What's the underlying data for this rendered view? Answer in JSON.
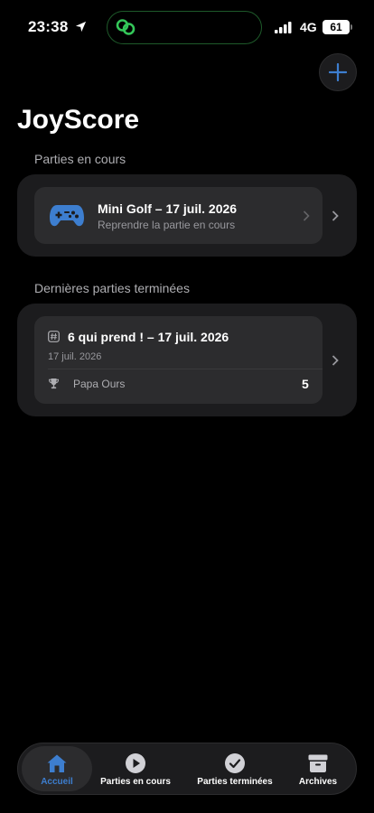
{
  "status_bar": {
    "time": "23:38",
    "network": "4G",
    "battery": "61"
  },
  "header": {
    "title": "JoyScore"
  },
  "in_progress": {
    "section_label": "Parties en cours",
    "game": {
      "title": "Mini Golf – 17 juil. 2026",
      "subtitle": "Reprendre la partie en cours"
    }
  },
  "finished": {
    "section_label": "Dernières parties terminées",
    "game": {
      "title": "6 qui prend ! – 17 juil. 2026",
      "date": "17 juil. 2026",
      "winner": "Papa Ours",
      "score": "5"
    }
  },
  "tabs": [
    {
      "label": "Accueil",
      "icon": "house-icon",
      "active": true
    },
    {
      "label": "Parties en cours",
      "icon": "play-circle-icon",
      "active": false
    },
    {
      "label": "Parties terminées",
      "icon": "checkmark-circle-icon",
      "active": false
    },
    {
      "label": "Archives",
      "icon": "archive-box-icon",
      "active": false
    }
  ],
  "colors": {
    "accent": "#3d7ecf",
    "background": "#000000",
    "card": "#1c1c1e",
    "inner_card": "#2c2c2e",
    "island_icon": "#34c759"
  }
}
